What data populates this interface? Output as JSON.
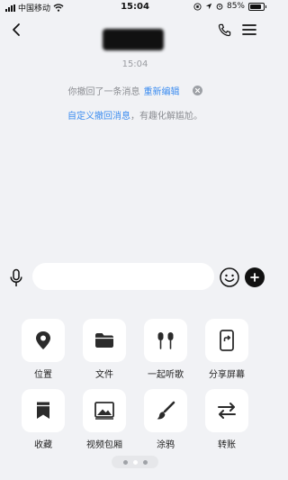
{
  "status_bar": {
    "carrier": "中国移动",
    "time": "15:04",
    "battery_percent": "85%",
    "battery_level": 0.85
  },
  "nav": {
    "back_icon": "chevron-left-icon",
    "phone_icon": "phone-icon",
    "menu_icon": "hamburger-menu-icon"
  },
  "chat": {
    "timestamp": "15:04",
    "recall_text": "你撤回了一条消息",
    "recall_action": "重新编辑",
    "custom_link": "自定义撤回消息",
    "custom_text": "，有趣化解尴尬。"
  },
  "input": {
    "placeholder": "",
    "value": ""
  },
  "panel": {
    "items": [
      {
        "label": "位置",
        "icon": "location-pin-icon"
      },
      {
        "label": "文件",
        "icon": "folder-icon"
      },
      {
        "label": "一起听歌",
        "icon": "earphones-icon"
      },
      {
        "label": "分享屏幕",
        "icon": "screen-share-icon"
      },
      {
        "label": "收藏",
        "icon": "bookmark-icon"
      },
      {
        "label": "视频包厢",
        "icon": "video-room-icon"
      },
      {
        "label": "涂鸦",
        "icon": "paint-brush-icon"
      },
      {
        "label": "转账",
        "icon": "transfer-arrows-icon"
      }
    ],
    "page_count": 3,
    "active_page": 2
  },
  "colors": {
    "background": "#f1f2f5",
    "accent_blue": "#3b8cf0",
    "muted_text": "#8b8d92"
  }
}
